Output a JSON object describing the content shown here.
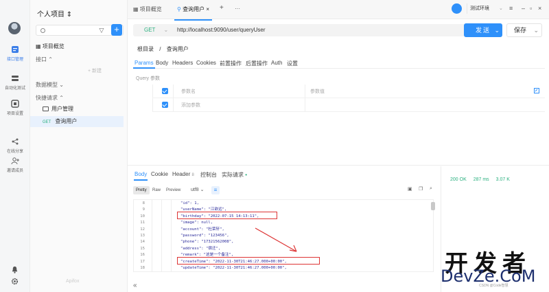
{
  "rail": {
    "items": [
      {
        "label": "接口管理",
        "active": true
      },
      {
        "label": "自动化测试",
        "active": false
      },
      {
        "label": "项目设置",
        "active": false
      },
      {
        "label": "在线分享",
        "active": false
      },
      {
        "label": "邀请成员",
        "active": false
      }
    ]
  },
  "sidebar": {
    "title": "个人项目",
    "overview": "项目概览",
    "api_section": "接口",
    "new_label": "+ 新建",
    "models": "数据模型",
    "quick": "快捷请求",
    "folder": "用户管理",
    "item_method": "GET",
    "item_label": "查询用户",
    "brand": "Apifox"
  },
  "tabs": {
    "overview": "项目概览",
    "query": "查询用户",
    "plus": "+",
    "more": "···"
  },
  "env": {
    "label": "测试环境"
  },
  "request": {
    "method": "GET",
    "url": "http://localhost:9090/user/queryUser",
    "send": "发送",
    "save": "保存",
    "breadcrumb_root": "根目录",
    "breadcrumb_sep": "/",
    "breadcrumb_current": "查询用户"
  },
  "req_tabs": [
    "Params",
    "Body",
    "Headers",
    "Cookies",
    "前置操作",
    "后置操作",
    "Auth",
    "设置"
  ],
  "params": {
    "section": "Query 参数",
    "col_name": "参数名",
    "col_value": "参数值",
    "add_placeholder": "添加参数"
  },
  "response": {
    "tabs": [
      {
        "label": "Body",
        "active": true
      },
      {
        "label": "Cookie",
        "active": false
      },
      {
        "label": "Header",
        "count": "8",
        "active": false
      },
      {
        "label": "控制台",
        "active": false
      },
      {
        "label": "实际请求",
        "active": false
      }
    ],
    "status": "200 OK",
    "time": "287 ms",
    "size": "3.07 K",
    "format_buttons": [
      "Pretty",
      "Raw",
      "Preview"
    ],
    "encoding": "utf8",
    "lines": [
      {
        "n": "8",
        "t": "\"id\": 1,"
      },
      {
        "n": "9",
        "t": "\"userName\": \"江欲远\","
      },
      {
        "n": "10",
        "t": "\"birthday\": \"2022-07-15 14:13:11\","
      },
      {
        "n": "11",
        "t": "\"image\": null,"
      },
      {
        "n": "12",
        "t": "\"account\": \"杜荣轩\","
      },
      {
        "n": "13",
        "t": "\"password\": \"123456\","
      },
      {
        "n": "14",
        "t": "\"phone\": \"17321562008\","
      },
      {
        "n": "15",
        "t": "\"address\": \"宿迁\","
      },
      {
        "n": "16",
        "t": "\"remark\": \"这是一个备注\","
      },
      {
        "n": "17",
        "t": "\"createTime\": \"2022-11-30T21:46:27.000+00:00\","
      },
      {
        "n": "18",
        "t": "\"updateTime\": \"2022-11-30T21:46:27.000+00:00\","
      }
    ]
  },
  "watermark": {
    "cn": "开发者",
    "en": "DevZe.CoM",
    "small": "CSDN @Code智慧"
  },
  "colors": {
    "accent": "#2e90fa",
    "get": "#2ab07f",
    "highlight": "#d33333"
  }
}
